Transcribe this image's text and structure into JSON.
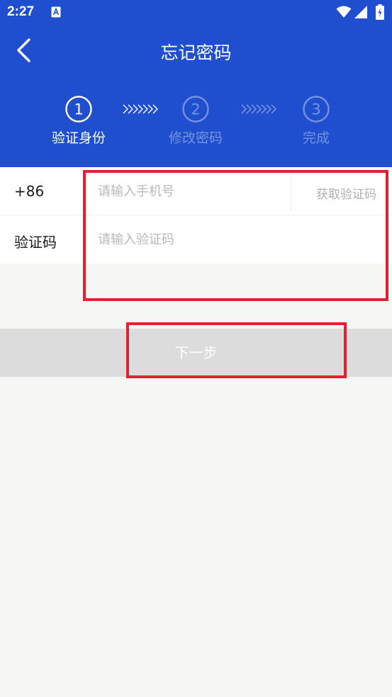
{
  "status_bar": {
    "time": "2:27",
    "icons": [
      "app-notification-icon",
      "wifi-icon",
      "signal-icon",
      "battery-icon"
    ]
  },
  "header": {
    "title": "忘记密码",
    "back_icon": "chevron-left-icon",
    "background_color": "#1f4fce"
  },
  "steps": [
    {
      "number": "1",
      "label": "验证身份",
      "active": true
    },
    {
      "number": "2",
      "label": "修改密码",
      "active": false
    },
    {
      "number": "3",
      "label": "完成",
      "active": false
    }
  ],
  "form": {
    "phone": {
      "prefix": "+86",
      "value": "",
      "placeholder": "请输入手机号",
      "get_code_label": "获取验证码"
    },
    "code": {
      "label": "验证码",
      "value": "",
      "placeholder": "请输入验证码"
    }
  },
  "next_button": {
    "label": "下一步",
    "background_color": "#dcdcdc"
  },
  "highlight_color": "#e3202f"
}
